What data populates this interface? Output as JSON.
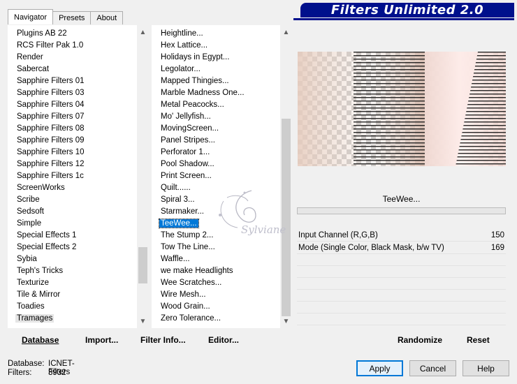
{
  "tabs": [
    "Navigator",
    "Presets",
    "About"
  ],
  "title": "Filters Unlimited 2.0",
  "categories": [
    "Plugins AB 22",
    "RCS Filter Pak 1.0",
    "Render",
    "Sabercat",
    "Sapphire Filters 01",
    "Sapphire Filters 03",
    "Sapphire Filters 04",
    "Sapphire Filters 07",
    "Sapphire Filters 08",
    "Sapphire Filters 09",
    "Sapphire Filters 10",
    "Sapphire Filters 12",
    "Sapphire Filters 1c",
    "ScreenWorks",
    "Scribe",
    "Sedsoft",
    "Simple",
    "Special Effects 1",
    "Special Effects 2",
    "Sybia",
    "Teph's Tricks",
    "Texturize",
    "Tile & Mirror",
    "Toadies",
    "Tramages"
  ],
  "filters": [
    "Heightline...",
    "Hex Lattice...",
    "Holidays in Egypt...",
    "Legolator...",
    "Mapped Thingies...",
    "Marble Madness One...",
    "Metal Peacocks...",
    "Mo' Jellyfish...",
    "MovingScreen...",
    "Panel Stripes...",
    "Perforator 1...",
    "Pool Shadow...",
    "Print Screen...",
    "Quilt......",
    "Spiral 3...",
    "Starmaker...",
    "TeeWee...",
    "The Stump 2...",
    "Tow The Line...",
    "Waffle...",
    "we make Headlights",
    "Wee Scratches...",
    "Wire Mesh...",
    "Wood Grain...",
    "Zero Tolerance..."
  ],
  "selected_filter_name": "TeeWee...",
  "params": [
    {
      "label": "Input Channel (R,G,B)",
      "value": "150"
    },
    {
      "label": "Mode (Single Color, Black Mask, b/w TV)",
      "value": "169"
    }
  ],
  "left_buttons": {
    "database": "Database",
    "import": "Import...",
    "filter_info": "Filter Info...",
    "editor": "Editor..."
  },
  "right_buttons": {
    "randomize": "Randomize",
    "reset": "Reset"
  },
  "status": {
    "database_label": "Database:",
    "database_value": "ICNET-Filters",
    "filters_label": "Filters:",
    "filters_value": "3932"
  },
  "dialog_buttons": {
    "apply": "Apply",
    "cancel": "Cancel",
    "help": "Help"
  },
  "watermark_text": "Sylviane",
  "colors": {
    "title_bg": "#00108c",
    "selection": "#0078d7"
  }
}
